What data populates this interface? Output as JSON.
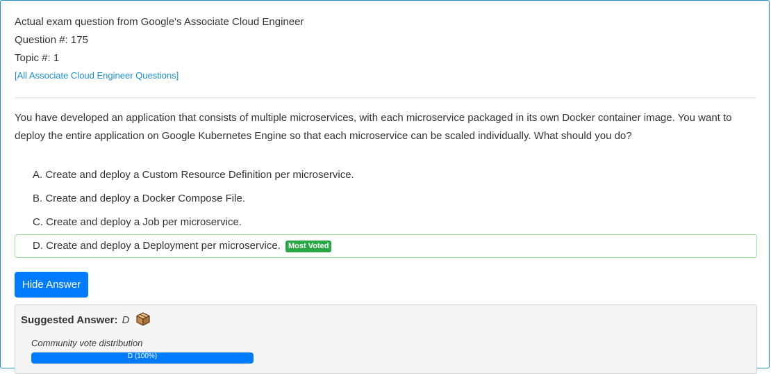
{
  "header": {
    "line1": "Actual exam question from Google's Associate Cloud Engineer",
    "question_number": "Question #: 175",
    "topic": "Topic #: 1",
    "all_questions_link": "[All Associate Cloud Engineer Questions]"
  },
  "question": {
    "text": "You have developed an application that consists of multiple microservices, with each microservice packaged in its own Docker container image. You want to deploy the entire application on Google Kubernetes Engine so that each microservice can be scaled individually. What should you do?"
  },
  "choices": [
    {
      "label": "A. Create and deploy a Custom Resource Definition per microservice."
    },
    {
      "label": "B. Create and deploy a Docker Compose File."
    },
    {
      "label": "C. Create and deploy a Job per microservice."
    },
    {
      "label": "D. Create and deploy a Deployment per microservice.",
      "badge": "Most Voted"
    }
  ],
  "hide_answer_button": "Hide Answer",
  "answer": {
    "suggested_label": "Suggested Answer:",
    "suggested_value": "D",
    "icon": "box-icon",
    "vote_label": "Community vote distribution",
    "vote_bar_text": "D (100%)",
    "vote_percent": 100
  },
  "colors": {
    "accent": "#007bff",
    "link": "#1a8fd6",
    "badge": "#28a745",
    "correct_border": "#9be29b"
  }
}
